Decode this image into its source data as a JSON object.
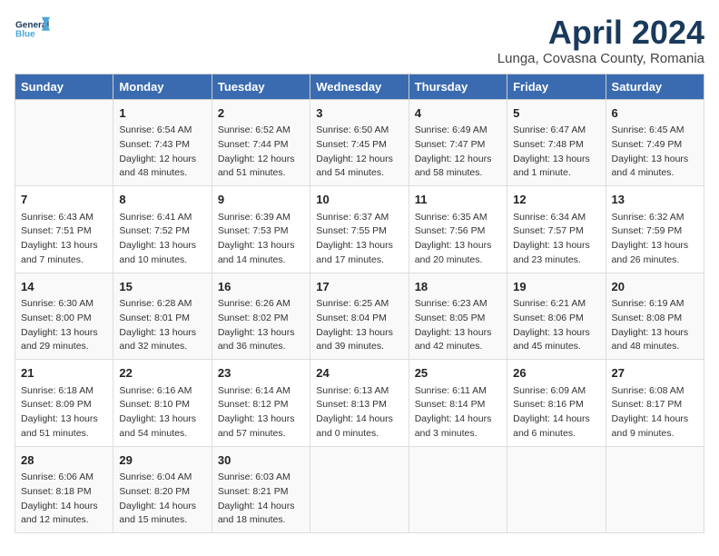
{
  "header": {
    "logo_line1": "General",
    "logo_line2": "Blue",
    "title": "April 2024",
    "subtitle": "Lunga, Covasna County, Romania"
  },
  "days_of_week": [
    "Sunday",
    "Monday",
    "Tuesday",
    "Wednesday",
    "Thursday",
    "Friday",
    "Saturday"
  ],
  "weeks": [
    [
      {
        "day": "",
        "content": ""
      },
      {
        "day": "1",
        "content": "Sunrise: 6:54 AM\nSunset: 7:43 PM\nDaylight: 12 hours\nand 48 minutes."
      },
      {
        "day": "2",
        "content": "Sunrise: 6:52 AM\nSunset: 7:44 PM\nDaylight: 12 hours\nand 51 minutes."
      },
      {
        "day": "3",
        "content": "Sunrise: 6:50 AM\nSunset: 7:45 PM\nDaylight: 12 hours\nand 54 minutes."
      },
      {
        "day": "4",
        "content": "Sunrise: 6:49 AM\nSunset: 7:47 PM\nDaylight: 12 hours\nand 58 minutes."
      },
      {
        "day": "5",
        "content": "Sunrise: 6:47 AM\nSunset: 7:48 PM\nDaylight: 13 hours\nand 1 minute."
      },
      {
        "day": "6",
        "content": "Sunrise: 6:45 AM\nSunset: 7:49 PM\nDaylight: 13 hours\nand 4 minutes."
      }
    ],
    [
      {
        "day": "7",
        "content": "Sunrise: 6:43 AM\nSunset: 7:51 PM\nDaylight: 13 hours\nand 7 minutes."
      },
      {
        "day": "8",
        "content": "Sunrise: 6:41 AM\nSunset: 7:52 PM\nDaylight: 13 hours\nand 10 minutes."
      },
      {
        "day": "9",
        "content": "Sunrise: 6:39 AM\nSunset: 7:53 PM\nDaylight: 13 hours\nand 14 minutes."
      },
      {
        "day": "10",
        "content": "Sunrise: 6:37 AM\nSunset: 7:55 PM\nDaylight: 13 hours\nand 17 minutes."
      },
      {
        "day": "11",
        "content": "Sunrise: 6:35 AM\nSunset: 7:56 PM\nDaylight: 13 hours\nand 20 minutes."
      },
      {
        "day": "12",
        "content": "Sunrise: 6:34 AM\nSunset: 7:57 PM\nDaylight: 13 hours\nand 23 minutes."
      },
      {
        "day": "13",
        "content": "Sunrise: 6:32 AM\nSunset: 7:59 PM\nDaylight: 13 hours\nand 26 minutes."
      }
    ],
    [
      {
        "day": "14",
        "content": "Sunrise: 6:30 AM\nSunset: 8:00 PM\nDaylight: 13 hours\nand 29 minutes."
      },
      {
        "day": "15",
        "content": "Sunrise: 6:28 AM\nSunset: 8:01 PM\nDaylight: 13 hours\nand 32 minutes."
      },
      {
        "day": "16",
        "content": "Sunrise: 6:26 AM\nSunset: 8:02 PM\nDaylight: 13 hours\nand 36 minutes."
      },
      {
        "day": "17",
        "content": "Sunrise: 6:25 AM\nSunset: 8:04 PM\nDaylight: 13 hours\nand 39 minutes."
      },
      {
        "day": "18",
        "content": "Sunrise: 6:23 AM\nSunset: 8:05 PM\nDaylight: 13 hours\nand 42 minutes."
      },
      {
        "day": "19",
        "content": "Sunrise: 6:21 AM\nSunset: 8:06 PM\nDaylight: 13 hours\nand 45 minutes."
      },
      {
        "day": "20",
        "content": "Sunrise: 6:19 AM\nSunset: 8:08 PM\nDaylight: 13 hours\nand 48 minutes."
      }
    ],
    [
      {
        "day": "21",
        "content": "Sunrise: 6:18 AM\nSunset: 8:09 PM\nDaylight: 13 hours\nand 51 minutes."
      },
      {
        "day": "22",
        "content": "Sunrise: 6:16 AM\nSunset: 8:10 PM\nDaylight: 13 hours\nand 54 minutes."
      },
      {
        "day": "23",
        "content": "Sunrise: 6:14 AM\nSunset: 8:12 PM\nDaylight: 13 hours\nand 57 minutes."
      },
      {
        "day": "24",
        "content": "Sunrise: 6:13 AM\nSunset: 8:13 PM\nDaylight: 14 hours\nand 0 minutes."
      },
      {
        "day": "25",
        "content": "Sunrise: 6:11 AM\nSunset: 8:14 PM\nDaylight: 14 hours\nand 3 minutes."
      },
      {
        "day": "26",
        "content": "Sunrise: 6:09 AM\nSunset: 8:16 PM\nDaylight: 14 hours\nand 6 minutes."
      },
      {
        "day": "27",
        "content": "Sunrise: 6:08 AM\nSunset: 8:17 PM\nDaylight: 14 hours\nand 9 minutes."
      }
    ],
    [
      {
        "day": "28",
        "content": "Sunrise: 6:06 AM\nSunset: 8:18 PM\nDaylight: 14 hours\nand 12 minutes."
      },
      {
        "day": "29",
        "content": "Sunrise: 6:04 AM\nSunset: 8:20 PM\nDaylight: 14 hours\nand 15 minutes."
      },
      {
        "day": "30",
        "content": "Sunrise: 6:03 AM\nSunset: 8:21 PM\nDaylight: 14 hours\nand 18 minutes."
      },
      {
        "day": "",
        "content": ""
      },
      {
        "day": "",
        "content": ""
      },
      {
        "day": "",
        "content": ""
      },
      {
        "day": "",
        "content": ""
      }
    ]
  ]
}
